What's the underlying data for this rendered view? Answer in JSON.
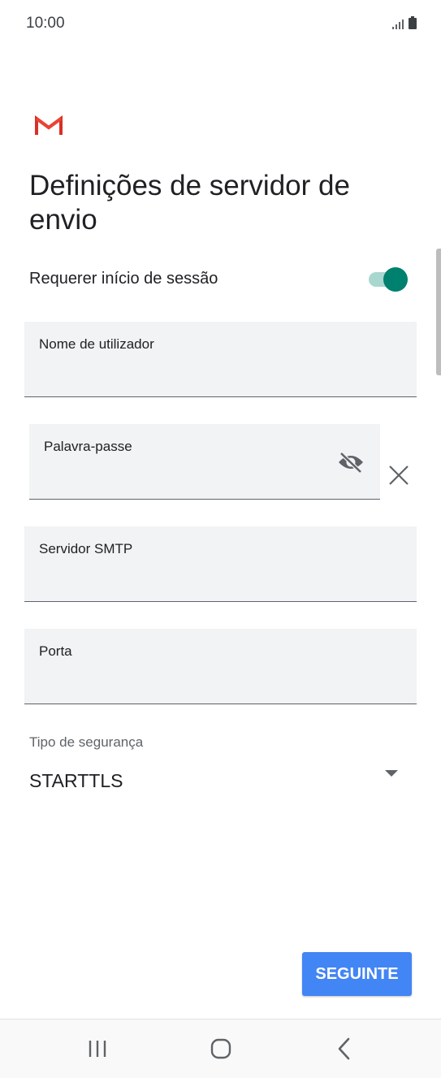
{
  "status_bar": {
    "time": "10:00"
  },
  "page": {
    "title": "Definições de servidor de envio"
  },
  "toggle": {
    "label": "Requerer início de sessão",
    "checked": true,
    "accent_color": "#00806e"
  },
  "fields": {
    "username": {
      "label": "Nome de utilizador",
      "value": ""
    },
    "password": {
      "label": "Palavra-passe",
      "value": ""
    },
    "smtp": {
      "label": "Servidor SMTP",
      "value": ""
    },
    "port": {
      "label": "Porta",
      "value": ""
    }
  },
  "security": {
    "label": "Tipo de segurança",
    "selected": "STARTTLS"
  },
  "next_button": {
    "label": "SEGUINTE",
    "color": "#4285f4"
  },
  "icons": {
    "logo": "gmail-logo",
    "password_visibility": "eye-off-icon",
    "clear": "close-icon",
    "dropdown": "caret-down-icon"
  }
}
